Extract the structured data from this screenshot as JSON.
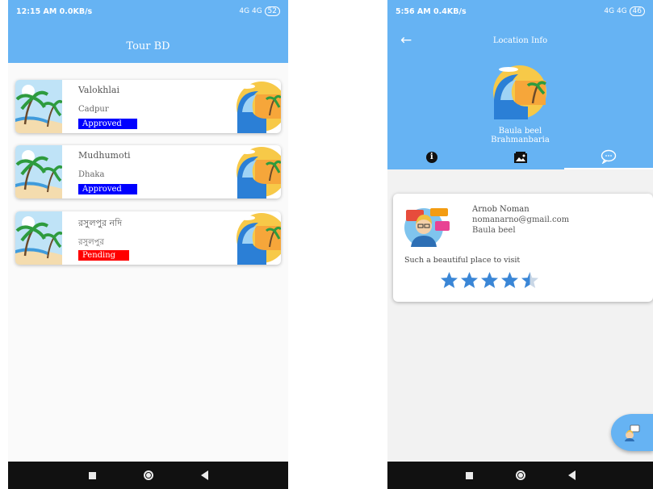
{
  "colors": {
    "primary": "#66b3f3",
    "approved": "#0000ff",
    "pending": "#ff0000"
  },
  "screen1": {
    "status": {
      "time_info": "12:15 AM 0.0KB/s",
      "signal_info": "4G 4G",
      "battery": "52"
    },
    "title": "Tour BD",
    "items": [
      {
        "name": "Valokhlai",
        "place": "Cadpur",
        "status": "Approved",
        "status_color": "#0000ff"
      },
      {
        "name": "Mudhumoti",
        "place": "Dhaka",
        "status": "Approved",
        "status_color": "#0000ff"
      },
      {
        "name": "রসুলপুর নদি",
        "place": "রসুলপুর",
        "status": "Pending",
        "status_color": "#ff0000"
      }
    ]
  },
  "screen2": {
    "status": {
      "time_info": "5:56 AM 0.4KB/s",
      "signal_info": "4G 4G",
      "battery": "46"
    },
    "back_icon": "arrow-left-icon",
    "title": "Location Info",
    "place_name": "Baula beel",
    "district": "Brahmanbaria",
    "tabs": [
      {
        "icon": "info-icon",
        "active": false
      },
      {
        "icon": "photo-icon",
        "active": false
      },
      {
        "icon": "chat-icon",
        "active": true
      }
    ],
    "review": {
      "name": "Arnob Noman",
      "email": "nomanarno@gmail.com",
      "place": "Baula beel",
      "comment": "Such a beautiful place to visit",
      "rating": 4.5
    },
    "fab_icon": "add-review-icon"
  }
}
